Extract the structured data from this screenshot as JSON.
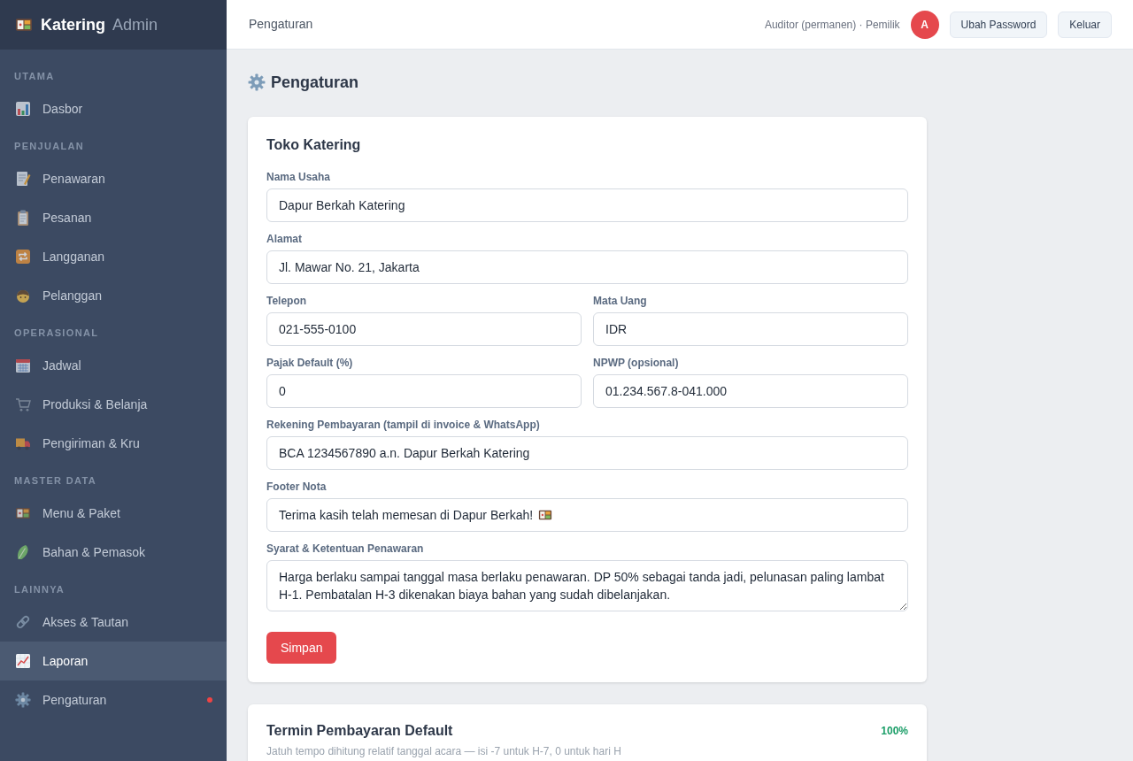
{
  "sidebar": {
    "brand": {
      "name": "Katering",
      "suffix": "Admin"
    },
    "sections": [
      {
        "title": "UTAMA",
        "items": [
          {
            "label": "Dasbor",
            "selected": false,
            "notification_dot": false
          }
        ]
      },
      {
        "title": "PENJUALAN",
        "items": [
          {
            "label": "Penawaran",
            "selected": false,
            "notification_dot": false
          },
          {
            "label": "Pesanan",
            "selected": false,
            "notification_dot": false
          },
          {
            "label": "Langganan",
            "selected": false,
            "notification_dot": false
          },
          {
            "label": "Pelanggan",
            "selected": false,
            "notification_dot": false
          }
        ]
      },
      {
        "title": "OPERASIONAL",
        "items": [
          {
            "label": "Jadwal",
            "selected": false,
            "notification_dot": false
          },
          {
            "label": "Produksi & Belanja",
            "selected": false,
            "notification_dot": false
          },
          {
            "label": "Pengiriman & Kru",
            "selected": false,
            "notification_dot": false
          }
        ]
      },
      {
        "title": "MASTER DATA",
        "items": [
          {
            "label": "Menu & Paket",
            "selected": false,
            "notification_dot": false
          },
          {
            "label": "Bahan & Pemasok",
            "selected": false,
            "notification_dot": false
          }
        ]
      },
      {
        "title": "LAINNYA",
        "items": [
          {
            "label": "Akses & Tautan",
            "selected": false,
            "notification_dot": false
          },
          {
            "label": "Laporan",
            "selected": true,
            "notification_dot": false
          },
          {
            "label": "Pengaturan",
            "selected": false,
            "notification_dot": true
          }
        ]
      }
    ]
  },
  "header": {
    "title": "Pengaturan",
    "user": "Auditor (permanen) · Pemilik",
    "avatar": "A",
    "buttons": [
      "Ubah Password",
      "Keluar"
    ]
  },
  "page": {
    "title": "Pengaturan"
  },
  "store_card": {
    "title": "Toko Katering",
    "rows": [
      [
        {
          "label": "Nama Usaha",
          "value": "Dapur Berkah Katering",
          "kind": "input",
          "trailing_icon": false
        }
      ],
      [
        {
          "label": "Alamat",
          "value": "Jl. Mawar No. 21, Jakarta",
          "kind": "input",
          "trailing_icon": false
        }
      ],
      [
        {
          "label": "Telepon",
          "value": "021-555-0100",
          "kind": "input",
          "trailing_icon": false
        },
        {
          "label": "Mata Uang",
          "value": "IDR",
          "kind": "input",
          "trailing_icon": false
        }
      ],
      [
        {
          "label": "Pajak Default (%)",
          "value": "0",
          "kind": "input",
          "trailing_icon": false
        },
        {
          "label": "NPWP (opsional)",
          "value": "01.234.567.8-041.000",
          "kind": "input",
          "trailing_icon": false
        }
      ],
      [
        {
          "label": "Rekening Pembayaran (tampil di invoice & WhatsApp)",
          "value": "BCA 1234567890 a.n. Dapur Berkah Katering",
          "kind": "input",
          "trailing_icon": false
        }
      ],
      [
        {
          "label": "Footer Nota",
          "value": "Terima kasih telah memesan di Dapur Berkah!",
          "kind": "input",
          "trailing_icon": true
        }
      ],
      [
        {
          "label": "Syarat & Ketentuan Penawaran",
          "value": "Harga berlaku sampai tanggal masa berlaku penawaran. DP 50% sebagai tanda jadi, pelunasan paling lambat H-1. Pembatalan H-3 dikenakan biaya bahan yang sudah dibelanjakan.",
          "kind": "textarea"
        }
      ]
    ],
    "save_button": "Simpan"
  },
  "terms_card": {
    "title": "Termin Pembayaran Default",
    "total": "100%",
    "description": "Jatuh tempo dihitung relatif tanggal acara — isi -7 untuk H-7, 0 untuk hari H"
  }
}
